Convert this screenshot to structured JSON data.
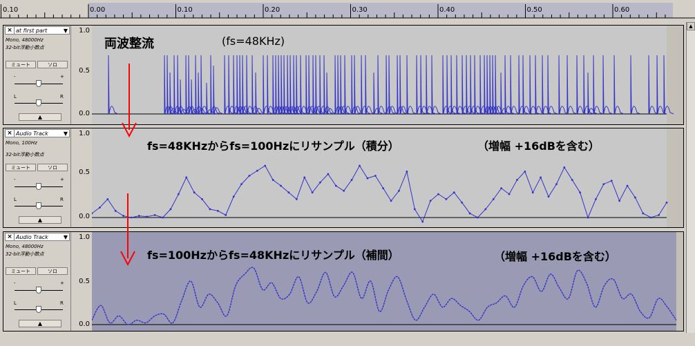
{
  "ruler": {
    "left_label": "0.10",
    "ticks": [
      "0.00",
      "0.10",
      "0.20",
      "0.30",
      "0.40",
      "0.50",
      "0.60"
    ]
  },
  "tracks": [
    {
      "name": "at first  part",
      "rate": "Mono, 48000Hz",
      "format": "32-bit浮動小数点",
      "mute_label": "ミュート",
      "solo_label": "ソロ",
      "gain_minus": "-",
      "gain_plus": "+",
      "pan_left": "L",
      "pan_right": "R",
      "vticks": [
        "1.0",
        "0.5",
        "0.0"
      ],
      "annotation_main": "両波整流",
      "annotation_sub": "(fs=48KHz)"
    },
    {
      "name": "Audio Track",
      "rate": "Mono, 100Hz",
      "format": "32-bit浮動小数点",
      "mute_label": "ミュート",
      "solo_label": "ソロ",
      "gain_minus": "-",
      "gain_plus": "+",
      "pan_left": "L",
      "pan_right": "R",
      "vticks": [
        "1.0",
        "0.5",
        "0.0"
      ],
      "annotation_main": "fs=48KHzからfs=100Hzにリサンプル（積分）",
      "annotation_sub": "（増幅 +16dBを含む）"
    },
    {
      "name": "Audio Track",
      "rate": "Mono, 48000Hz",
      "format": "32-bit浮動小数点",
      "mute_label": "ミュート",
      "solo_label": "ソロ",
      "gain_minus": "-",
      "gain_plus": "+",
      "pan_left": "L",
      "pan_right": "R",
      "vticks": [
        "1.0",
        "0.5",
        "0.0"
      ],
      "annotation_main": "fs=100Hzからfs=48KHzにリサンプル（補間）",
      "annotation_sub": "（増幅 +16dBを含む）"
    }
  ],
  "colors": {
    "waveform": "#3232c8",
    "arrow": "#ff0000",
    "selected_bg": "#9a9ab4",
    "track_bg": "#c8c8c8"
  },
  "chart_data": {
    "type": "line",
    "series": [
      {
        "values": [
          0.05,
          0.12,
          0.22,
          0.08,
          0.02,
          0.0,
          0.02,
          0.01,
          0.03,
          0.0,
          0.1,
          0.28,
          0.48,
          0.3,
          0.22,
          0.1,
          0.08,
          0.03,
          0.25,
          0.4,
          0.5,
          0.56,
          0.62,
          0.45,
          0.38,
          0.3,
          0.22,
          0.48,
          0.3,
          0.42,
          0.52,
          0.38,
          0.32,
          0.45,
          0.62,
          0.47,
          0.5,
          0.35,
          0.2,
          0.32,
          0.55,
          0.1,
          -0.05,
          0.2,
          0.28,
          0.22,
          0.3,
          0.18,
          0.05,
          0.0,
          0.1,
          0.22,
          0.35,
          0.28,
          0.45,
          0.55,
          0.3,
          0.48,
          0.25,
          0.4,
          0.6,
          0.45,
          0.3,
          0.0,
          0.22,
          0.4,
          0.44,
          0.2,
          0.38,
          0.24,
          0.05,
          0.0,
          0.03,
          0.18
        ]
      },
      {
        "values": [
          0.05,
          0.22,
          0.02,
          0.1,
          0.0,
          0.05,
          0.02,
          0.1,
          0.12,
          0.02,
          0.28,
          0.5,
          0.2,
          0.35,
          0.25,
          0.1,
          0.45,
          0.58,
          0.65,
          0.4,
          0.48,
          0.3,
          0.35,
          0.55,
          0.25,
          0.38,
          0.6,
          0.32,
          0.45,
          0.6,
          0.3,
          0.5,
          0.15,
          0.4,
          0.55,
          0.28,
          0.05,
          0.2,
          0.35,
          0.2,
          0.3,
          0.22,
          0.15,
          0.05,
          0.2,
          0.25,
          0.33,
          0.2,
          0.45,
          0.55,
          0.38,
          0.58,
          0.42,
          0.3,
          0.62,
          0.48,
          0.2,
          0.45,
          0.52,
          0.3,
          0.35,
          0.15,
          0.08,
          0.3,
          0.2,
          0.05
        ]
      }
    ]
  }
}
